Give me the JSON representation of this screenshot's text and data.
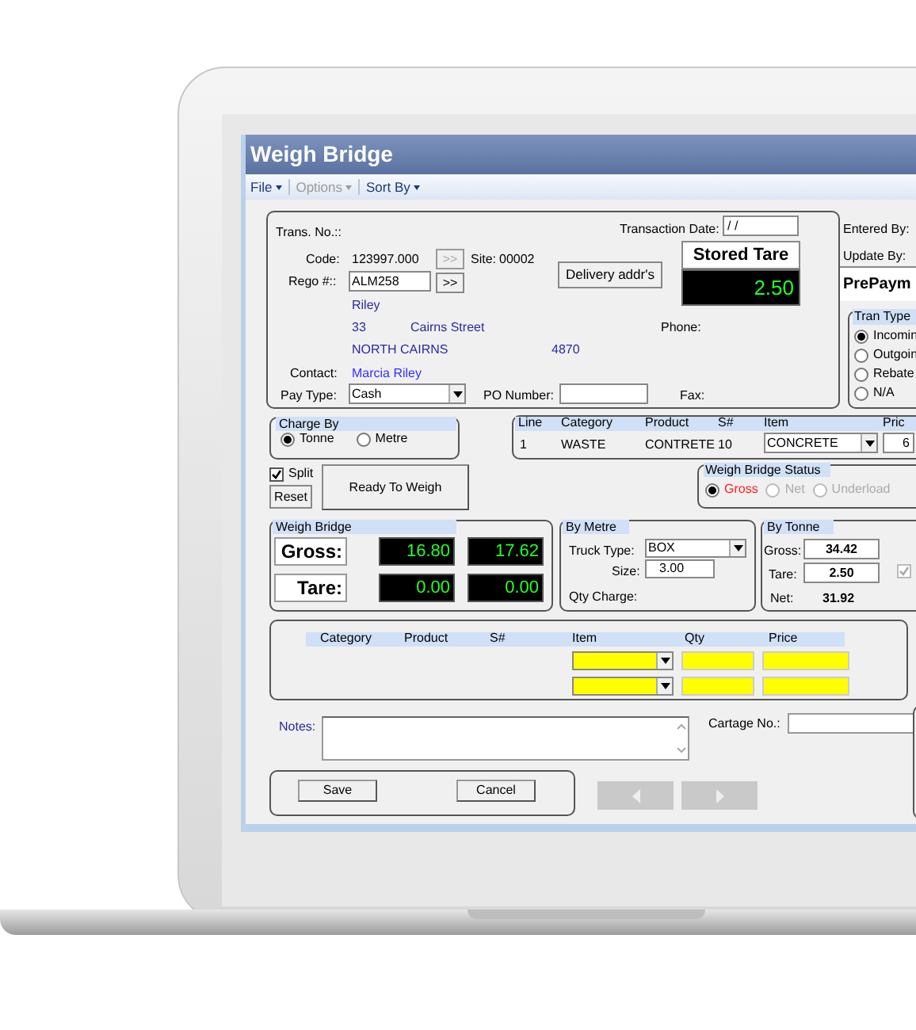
{
  "window": {
    "title": "Weigh Bridge"
  },
  "menu": [
    {
      "label": "File",
      "disabled": false
    },
    {
      "label": "Options",
      "disabled": true
    },
    {
      "label": "Sort By",
      "disabled": false
    }
  ],
  "transaction": {
    "trans_no_label": "Trans. No.::",
    "code_label": "Code:",
    "code": "123997.000",
    "code_button": {
      "label": ">>",
      "disabled": true
    },
    "site_label": "Site:",
    "site": "00002",
    "rego_label": "Rego #::",
    "rego": "ALM258",
    "rego_button": {
      "label": ">>",
      "disabled": false
    },
    "name": "Riley",
    "street_no": "33",
    "street": "Cairns Street",
    "suburb": "NORTH CAIRNS",
    "postcode": "4870",
    "contact_label": "Contact:",
    "contact": "Marcia Riley",
    "pay_type_label": "Pay Type:",
    "pay_type": "Cash",
    "po_label": "PO Number:",
    "fax_label": "Fax:",
    "phone_label": "Phone:",
    "date_label": "Transaction Date:",
    "date": "/ /",
    "delivery_button": "Delivery addr's",
    "stored_tare_label": "Stored Tare",
    "stored_tare": "2.50"
  },
  "side": {
    "entered_by_label": "Entered By:",
    "update_by_label": "Update By:",
    "payment": "PrePaym"
  },
  "tran_type": {
    "title": "Tran Type",
    "options": [
      {
        "label": "Incomin",
        "selected": true
      },
      {
        "label": "Outgoin",
        "selected": false
      },
      {
        "label": "Rebate",
        "selected": false
      },
      {
        "label": "N/A",
        "selected": false
      }
    ]
  },
  "charge_by": {
    "title": "Charge By",
    "options": [
      {
        "label": "Tonne",
        "selected": true
      },
      {
        "label": "Metre",
        "selected": false
      }
    ]
  },
  "line_table": {
    "columns": [
      "Line",
      "Category",
      "Product",
      "S#",
      "Item",
      "Pric"
    ],
    "row": {
      "line": "1",
      "category": "WASTE",
      "product": "CONTRETE",
      "s": "10",
      "item": "CONCRETE",
      "price": "6"
    }
  },
  "split": {
    "label": "Split",
    "checked": true
  },
  "reset_button": "Reset",
  "ready_button": "Ready To Weigh",
  "status": {
    "title": "Weigh Bridge Status",
    "options": [
      {
        "label": "Gross",
        "selected": true,
        "disabled": false
      },
      {
        "label": "Net",
        "selected": false,
        "disabled": true
      },
      {
        "label": "Underload",
        "selected": false,
        "disabled": true
      }
    ]
  },
  "weigh_bridge": {
    "title": "Weigh Bridge",
    "rows": [
      {
        "label": "Gross:",
        "values": [
          "16.80",
          "17.62"
        ]
      },
      {
        "label": "Tare:",
        "values": [
          "0.00",
          "0.00"
        ]
      }
    ]
  },
  "by_metre": {
    "title": "By Metre",
    "truck_type_label": "Truck Type:",
    "truck_type": "BOX",
    "size_label": "Size:",
    "size": "3.00",
    "qty_charge_label": "Qty Charge:"
  },
  "by_tonne": {
    "title": "By Tonne",
    "gross_label": "Gross:",
    "gross": "34.42",
    "tare_label": "Tare:",
    "tare": "2.50",
    "net_label": "Net:",
    "net": "31.92",
    "checkbox": {
      "checked": true,
      "disabled": true
    }
  },
  "items": {
    "columns": [
      "Category",
      "Product",
      "S#",
      "Item",
      "Qty",
      "Price"
    ],
    "rows": [
      {
        "required": true
      },
      {
        "required": true
      }
    ]
  },
  "notes_label": "Notes:",
  "cartage_label": "Cartage No.:",
  "save_button": "Save",
  "cancel_button": "Cancel"
}
